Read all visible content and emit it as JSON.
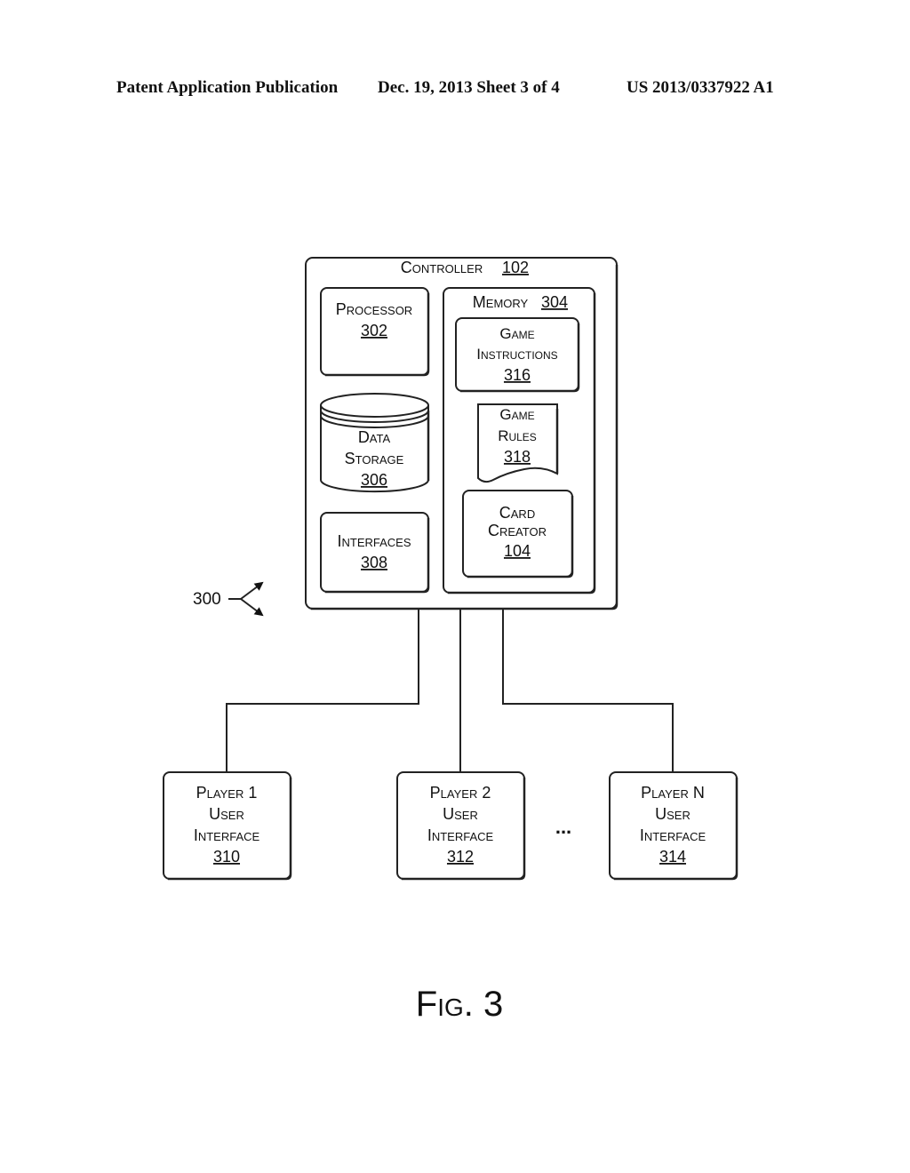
{
  "header": {
    "left": "Patent Application Publication",
    "middle": "Dec. 19, 2013   Sheet 3 of 4",
    "right": "US 2013/0337922 A1"
  },
  "diagram": {
    "reference_label": "300",
    "controller": {
      "title": "Controller",
      "ref": "102"
    },
    "processor": {
      "title": "Processor",
      "ref": "302"
    },
    "data_storage": {
      "line1": "Data",
      "line2": "Storage",
      "ref": "306"
    },
    "interfaces": {
      "title": "Interfaces",
      "ref": "308"
    },
    "memory": {
      "title": "Memory",
      "ref": "304"
    },
    "game_instructions": {
      "line1": "Game",
      "line2": "Instructions",
      "ref": "316"
    },
    "game_rules": {
      "line1": "Game",
      "line2": "Rules",
      "ref": "318"
    },
    "card_creator": {
      "line1": "Card",
      "line2": "Creator",
      "ref": "104"
    },
    "players": [
      {
        "line1": "Player 1",
        "line2": "User",
        "line3": "Interface",
        "ref": "310"
      },
      {
        "line1": "Player 2",
        "line2": "User",
        "line3": "Interface",
        "ref": "312"
      },
      {
        "line1": "Player N",
        "line2": "User",
        "line3": "Interface",
        "ref": "314"
      }
    ],
    "ellipsis": "...",
    "figure_caption": "Fig. 3"
  }
}
